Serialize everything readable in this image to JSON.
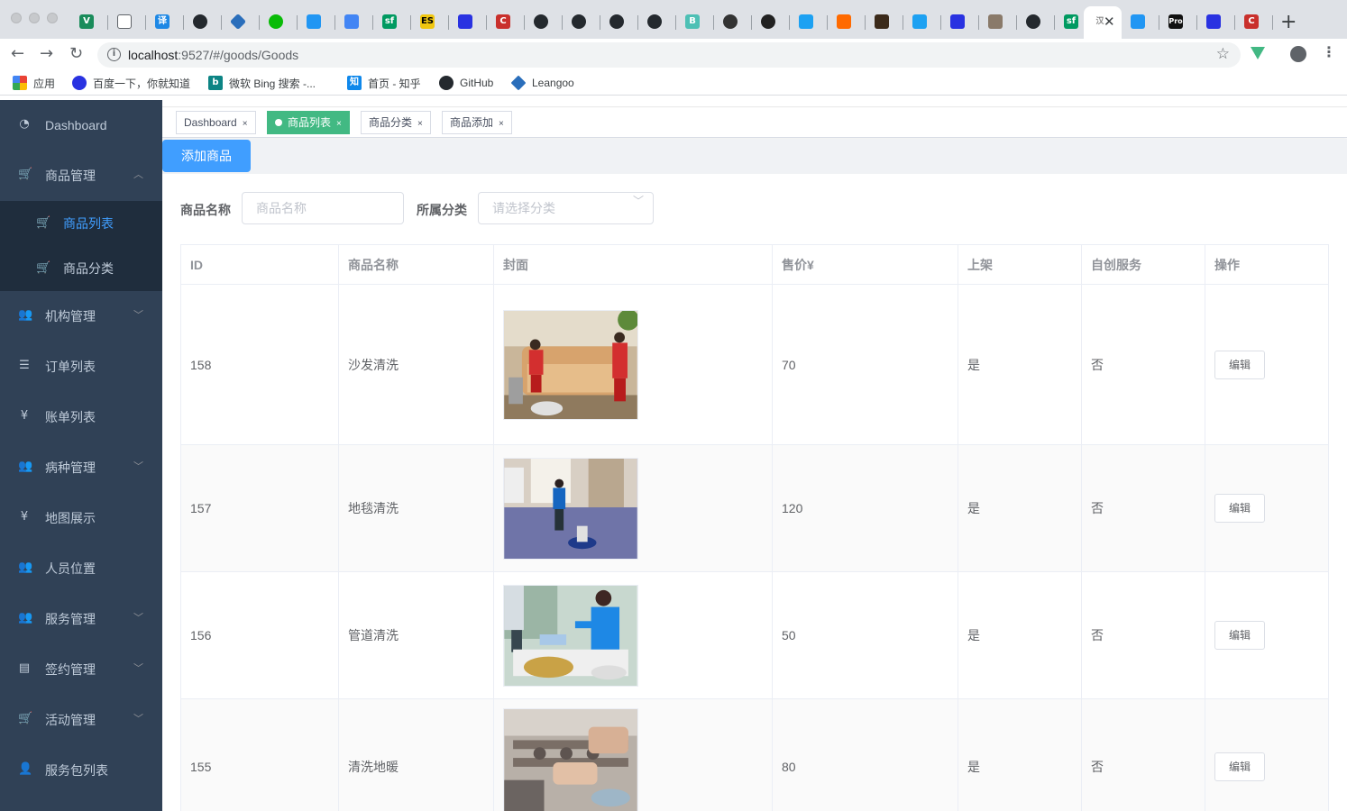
{
  "browser": {
    "url_host": "localhost",
    "url_path": ":9527/#/goods/Goods",
    "bookmarks": [
      {
        "label": "应用",
        "icon": "apps-grid-icon"
      },
      {
        "label": "百度一下，你就知道",
        "icon": "baidu-icon"
      },
      {
        "label": "微软 Bing 搜索 -...",
        "icon": "bing-icon"
      },
      {
        "label": "首页 - 知乎",
        "icon": "zhihu-icon"
      },
      {
        "label": "GitHub",
        "icon": "github-icon"
      },
      {
        "label": "Leangoo",
        "icon": "leangoo-icon"
      }
    ],
    "colors": {
      "chrome_bg": "#dee1e6",
      "omnibox_bg": "#f1f3f4"
    }
  },
  "sidebar": {
    "items": [
      {
        "label": "Dashboard",
        "icon": "dashboard-icon",
        "has_arrow": false
      },
      {
        "label": "商品管理",
        "icon": "cart-icon",
        "has_arrow": true,
        "expanded": true
      },
      {
        "label": "机构管理",
        "icon": "people-icon",
        "has_arrow": true
      },
      {
        "label": "订单列表",
        "icon": "list-icon",
        "has_arrow": false
      },
      {
        "label": "账单列表",
        "icon": "yen-icon",
        "has_arrow": false
      },
      {
        "label": "病种管理",
        "icon": "people-icon",
        "has_arrow": true
      },
      {
        "label": "地图展示",
        "icon": "yen-icon",
        "has_arrow": false
      },
      {
        "label": "人员位置",
        "icon": "people-icon",
        "has_arrow": false
      },
      {
        "label": "服务管理",
        "icon": "people-icon",
        "has_arrow": true
      },
      {
        "label": "签约管理",
        "icon": "document-icon",
        "has_arrow": true
      },
      {
        "label": "活动管理",
        "icon": "cart-icon",
        "has_arrow": true
      },
      {
        "label": "服务包列表",
        "icon": "user-icon",
        "has_arrow": false
      }
    ],
    "submenu": [
      {
        "label": "商品列表",
        "icon": "cart-icon",
        "active": true
      },
      {
        "label": "商品分类",
        "icon": "cart-icon",
        "active": false
      }
    ],
    "colors": {
      "bg": "#304156",
      "submenu_bg": "#1f2d3d",
      "text": "#bfcbd9",
      "active": "#409eff"
    }
  },
  "tags": [
    {
      "label": "Dashboard",
      "active": false
    },
    {
      "label": "商品列表",
      "active": true
    },
    {
      "label": "商品分类",
      "active": false
    },
    {
      "label": "商品添加",
      "active": false
    }
  ],
  "toolbar": {
    "add_label": "添加商品"
  },
  "filters": {
    "name_label": "商品名称",
    "name_placeholder": "商品名称",
    "category_label": "所属分类",
    "category_placeholder": "请选择分类"
  },
  "table": {
    "columns": [
      "ID",
      "商品名称",
      "封面",
      "售价¥",
      "上架",
      "自创服务",
      "操作"
    ],
    "rows": [
      {
        "id": "158",
        "name": "沙发清洗",
        "cover": "sofa-cleaning-photo",
        "price": "70",
        "on_shelf": "是",
        "self_created": "否",
        "action": "编辑"
      },
      {
        "id": "157",
        "name": "地毯清洗",
        "cover": "carpet-cleaning-photo",
        "price": "120",
        "on_shelf": "是",
        "self_created": "否",
        "action": "编辑"
      },
      {
        "id": "156",
        "name": "管道清洗",
        "cover": "pipe-cleaning-photo",
        "price": "50",
        "on_shelf": "是",
        "self_created": "否",
        "action": "编辑"
      },
      {
        "id": "155",
        "name": "清洗地暖",
        "cover": "floor-heating-cleaning-photo",
        "price": "80",
        "on_shelf": "是",
        "self_created": "否",
        "action": "编辑"
      }
    ]
  },
  "colors": {
    "primary": "#409eff",
    "tag_active": "#42b983"
  }
}
